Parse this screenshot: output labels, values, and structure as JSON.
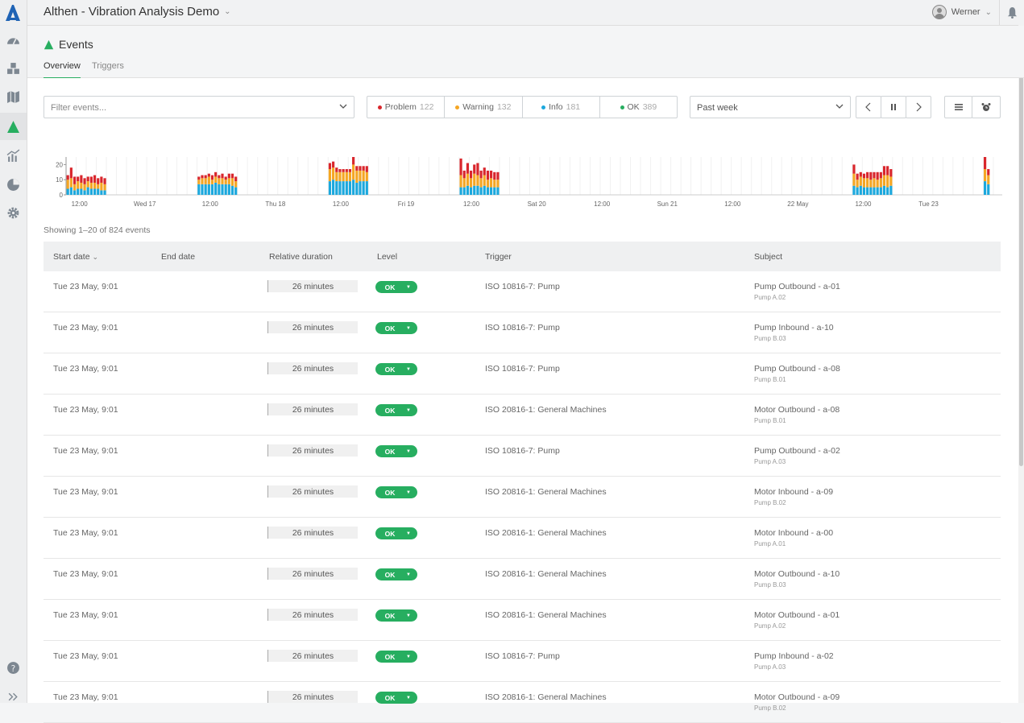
{
  "app": {
    "title": "Althen - Vibration Analysis Demo",
    "user": "Werner"
  },
  "sidebar": [
    {
      "icon": "dashboard-icon",
      "active": false
    },
    {
      "icon": "groups-icon",
      "active": false
    },
    {
      "icon": "map-icon",
      "active": false
    },
    {
      "icon": "alarm-triangle-icon",
      "active": true
    },
    {
      "icon": "measurements-icon",
      "active": false
    },
    {
      "icon": "reports-icon",
      "active": false
    },
    {
      "icon": "settings-icon",
      "active": false
    }
  ],
  "page": {
    "title": "Events",
    "tabs": [
      "Overview",
      "Triggers"
    ]
  },
  "filter": {
    "placeholder": "Filter events..."
  },
  "levels": [
    {
      "label": "Problem",
      "count": "122",
      "color": "#d9262c"
    },
    {
      "label": "Warning",
      "count": "132",
      "color": "#f5a623"
    },
    {
      "label": "Info",
      "count": "181",
      "color": "#1ca8dd"
    },
    {
      "label": "OK",
      "count": "389",
      "color": "#27ae60"
    }
  ],
  "range": "Past week",
  "chart_data": {
    "type": "bar",
    "stacked": true,
    "ylim": [
      0,
      25
    ],
    "yticks": [
      "20",
      "10",
      "0"
    ],
    "xticks": [
      "12:00",
      "Wed 17",
      "12:00",
      "Thu 18",
      "12:00",
      "Fri 19",
      "12:00",
      "Sat 20",
      "12:00",
      "Sun 21",
      "12:00",
      "22 May",
      "12:00",
      "Tue 23"
    ],
    "series": [
      {
        "name": "Info",
        "color": "#1ca8dd"
      },
      {
        "name": "Warning",
        "color": "#f5a623"
      },
      {
        "name": "Problem",
        "color": "#d9262c"
      }
    ],
    "bars": [
      {
        "i": 0,
        "v": [
          4,
          6,
          3
        ]
      },
      {
        "i": 1,
        "v": [
          5,
          6,
          7
        ]
      },
      {
        "i": 2,
        "v": [
          3,
          4,
          5
        ]
      },
      {
        "i": 3,
        "v": [
          4,
          5,
          3
        ]
      },
      {
        "i": 4,
        "v": [
          4,
          4,
          5
        ]
      },
      {
        "i": 5,
        "v": [
          3,
          4,
          4
        ]
      },
      {
        "i": 6,
        "v": [
          5,
          4,
          3
        ]
      },
      {
        "i": 7,
        "v": [
          4,
          4,
          4
        ]
      },
      {
        "i": 8,
        "v": [
          4,
          4,
          5
        ]
      },
      {
        "i": 9,
        "v": [
          4,
          3,
          4
        ]
      },
      {
        "i": 10,
        "v": [
          3,
          5,
          4
        ]
      },
      {
        "i": 11,
        "v": [
          3,
          4,
          4
        ]
      },
      {
        "i": 39,
        "v": [
          7,
          3,
          2
        ]
      },
      {
        "i": 40,
        "v": [
          7,
          4,
          2
        ]
      },
      {
        "i": 41,
        "v": [
          7,
          4,
          2
        ]
      },
      {
        "i": 42,
        "v": [
          7,
          5,
          2
        ]
      },
      {
        "i": 43,
        "v": [
          7,
          3,
          3
        ]
      },
      {
        "i": 44,
        "v": [
          8,
          4,
          3
        ]
      },
      {
        "i": 45,
        "v": [
          7,
          4,
          2
        ]
      },
      {
        "i": 46,
        "v": [
          7,
          4,
          3
        ]
      },
      {
        "i": 47,
        "v": [
          7,
          3,
          2
        ]
      },
      {
        "i": 48,
        "v": [
          7,
          4,
          3
        ]
      },
      {
        "i": 49,
        "v": [
          6,
          5,
          3
        ]
      },
      {
        "i": 50,
        "v": [
          5,
          4,
          3
        ]
      },
      {
        "i": 78,
        "v": [
          9,
          8,
          4
        ]
      },
      {
        "i": 79,
        "v": [
          10,
          8,
          4
        ]
      },
      {
        "i": 80,
        "v": [
          9,
          6,
          3
        ]
      },
      {
        "i": 81,
        "v": [
          9,
          6,
          2
        ]
      },
      {
        "i": 82,
        "v": [
          9,
          6,
          2
        ]
      },
      {
        "i": 83,
        "v": [
          9,
          6,
          2
        ]
      },
      {
        "i": 84,
        "v": [
          9,
          6,
          2
        ]
      },
      {
        "i": 85,
        "v": [
          10,
          10,
          5
        ]
      },
      {
        "i": 86,
        "v": [
          8,
          8,
          3
        ]
      },
      {
        "i": 87,
        "v": [
          9,
          7,
          3
        ]
      },
      {
        "i": 88,
        "v": [
          9,
          7,
          3
        ]
      },
      {
        "i": 89,
        "v": [
          9,
          6,
          4
        ]
      },
      {
        "i": 117,
        "v": [
          5,
          8,
          11
        ]
      },
      {
        "i": 118,
        "v": [
          5,
          6,
          5
        ]
      },
      {
        "i": 119,
        "v": [
          6,
          8,
          7
        ]
      },
      {
        "i": 120,
        "v": [
          5,
          6,
          5
        ]
      },
      {
        "i": 121,
        "v": [
          6,
          8,
          6
        ]
      },
      {
        "i": 122,
        "v": [
          6,
          7,
          8
        ]
      },
      {
        "i": 123,
        "v": [
          5,
          6,
          5
        ]
      },
      {
        "i": 124,
        "v": [
          6,
          7,
          5
        ]
      },
      {
        "i": 125,
        "v": [
          5,
          5,
          6
        ]
      },
      {
        "i": 126,
        "v": [
          5,
          6,
          5
        ]
      },
      {
        "i": 127,
        "v": [
          5,
          5,
          5
        ]
      },
      {
        "i": 128,
        "v": [
          5,
          5,
          5
        ]
      },
      {
        "i": 234,
        "v": [
          6,
          8,
          6
        ]
      },
      {
        "i": 235,
        "v": [
          5,
          5,
          4
        ]
      },
      {
        "i": 236,
        "v": [
          6,
          6,
          3
        ]
      },
      {
        "i": 237,
        "v": [
          5,
          6,
          3
        ]
      },
      {
        "i": 238,
        "v": [
          5,
          6,
          4
        ]
      },
      {
        "i": 239,
        "v": [
          5,
          5,
          5
        ]
      },
      {
        "i": 240,
        "v": [
          5,
          6,
          4
        ]
      },
      {
        "i": 241,
        "v": [
          5,
          5,
          5
        ]
      },
      {
        "i": 242,
        "v": [
          5,
          6,
          4
        ]
      },
      {
        "i": 243,
        "v": [
          6,
          7,
          6
        ]
      },
      {
        "i": 244,
        "v": [
          5,
          8,
          6
        ]
      },
      {
        "i": 245,
        "v": [
          6,
          6,
          5
        ]
      },
      {
        "i": 273,
        "v": [
          9,
          8,
          8
        ]
      },
      {
        "i": 274,
        "v": [
          7,
          6,
          4
        ]
      }
    ]
  },
  "showing": "Showing 1–20 of 824 events",
  "table": {
    "headers": [
      "Start date",
      "End date",
      "Relative duration",
      "Level",
      "Trigger",
      "Subject"
    ],
    "rows": [
      {
        "start": "Tue 23 May, 9:01",
        "end": "",
        "duration": "26 minutes",
        "level": "OK",
        "trigger": "ISO 10816-7: Pump",
        "subject": "Pump Outbound - a-01",
        "sub": "Pump A.02"
      },
      {
        "start": "Tue 23 May, 9:01",
        "end": "",
        "duration": "26 minutes",
        "level": "OK",
        "trigger": "ISO 10816-7: Pump",
        "subject": "Pump Inbound - a-10",
        "sub": "Pump B.03"
      },
      {
        "start": "Tue 23 May, 9:01",
        "end": "",
        "duration": "26 minutes",
        "level": "OK",
        "trigger": "ISO 10816-7: Pump",
        "subject": "Pump Outbound - a-08",
        "sub": "Pump B.01"
      },
      {
        "start": "Tue 23 May, 9:01",
        "end": "",
        "duration": "26 minutes",
        "level": "OK",
        "trigger": "ISO 20816-1: General Machines",
        "subject": "Motor Outbound - a-08",
        "sub": "Pump B.01"
      },
      {
        "start": "Tue 23 May, 9:01",
        "end": "",
        "duration": "26 minutes",
        "level": "OK",
        "trigger": "ISO 10816-7: Pump",
        "subject": "Pump Outbound - a-02",
        "sub": "Pump A.03"
      },
      {
        "start": "Tue 23 May, 9:01",
        "end": "",
        "duration": "26 minutes",
        "level": "OK",
        "trigger": "ISO 20816-1: General Machines",
        "subject": "Motor Inbound - a-09",
        "sub": "Pump B.02"
      },
      {
        "start": "Tue 23 May, 9:01",
        "end": "",
        "duration": "26 minutes",
        "level": "OK",
        "trigger": "ISO 20816-1: General Machines",
        "subject": "Motor Inbound - a-00",
        "sub": "Pump A.01"
      },
      {
        "start": "Tue 23 May, 9:01",
        "end": "",
        "duration": "26 minutes",
        "level": "OK",
        "trigger": "ISO 20816-1: General Machines",
        "subject": "Motor Outbound - a-10",
        "sub": "Pump B.03"
      },
      {
        "start": "Tue 23 May, 9:01",
        "end": "",
        "duration": "26 minutes",
        "level": "OK",
        "trigger": "ISO 20816-1: General Machines",
        "subject": "Motor Outbound - a-01",
        "sub": "Pump A.02"
      },
      {
        "start": "Tue 23 May, 9:01",
        "end": "",
        "duration": "26 minutes",
        "level": "OK",
        "trigger": "ISO 10816-7: Pump",
        "subject": "Pump Inbound - a-02",
        "sub": "Pump A.03"
      },
      {
        "start": "Tue 23 May, 9:01",
        "end": "",
        "duration": "26 minutes",
        "level": "OK",
        "trigger": "ISO 20816-1: General Machines",
        "subject": "Motor Outbound - a-09",
        "sub": "Pump B.02"
      }
    ]
  }
}
